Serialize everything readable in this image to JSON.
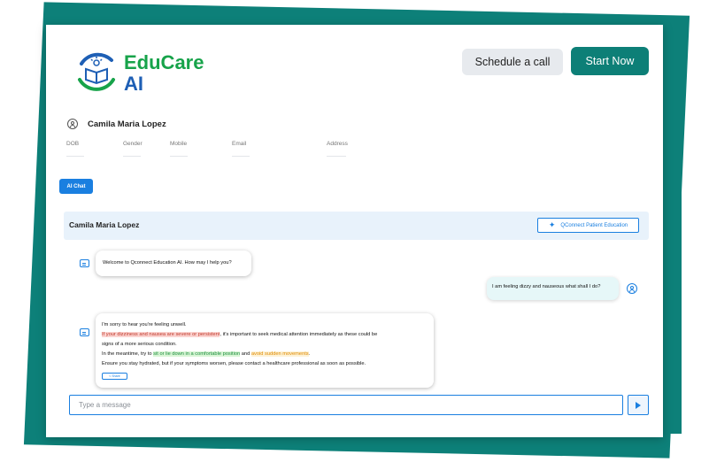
{
  "brand": {
    "name_line1": "EduCare",
    "name_line2": "AI",
    "green": "#17a34a",
    "blue": "#1e5fb5"
  },
  "header": {
    "schedule_label": "Schedule a call",
    "start_label": "Start Now",
    "accent": "#0d7f77"
  },
  "patient": {
    "name": "Camila Maria Lopez",
    "fields": [
      {
        "label": "DOB",
        "value": ""
      },
      {
        "label": "Gender",
        "value": ""
      },
      {
        "label": "Mobile",
        "value": ""
      },
      {
        "label": "Email",
        "value": ""
      },
      {
        "label": "Address",
        "value": ""
      }
    ]
  },
  "tabs": {
    "ai_chat": "AI Chat"
  },
  "chat": {
    "header_name": "Camila Maria Lopez",
    "qconnect_label": "QConnect Patient Education",
    "messages": [
      {
        "role": "bot",
        "text": "Welcome to Qconnect Education AI. How may I help you?"
      },
      {
        "role": "user",
        "text": "I am feeling dizzy and nauseous what shall I do?"
      },
      {
        "role": "bot",
        "line1": "I'm sorry to hear you're feeling unwell.",
        "line2_hl": "If your dizziness and nausea are severe or persistent",
        "line2_rest": ", it's important to seek medical attention immediately as these could be",
        "line3": "signs of a more serious condition.",
        "line4_a": "In the meantime, try to ",
        "line4_hl1": "sit or lie down in a comfortable position",
        "line4_b": " and ",
        "line4_hl2": "avoid sudden movements",
        "line4_c": ".",
        "line5": "Ensure you stay hydrated, but if your symptoms worsen, please contact a healthcare professional as soon as possible.",
        "share_label": "Share"
      }
    ],
    "input_placeholder": "Type a message"
  },
  "icons": [
    "user-icon",
    "sparkle-icon",
    "bot-icon",
    "share-icon",
    "send-icon"
  ]
}
